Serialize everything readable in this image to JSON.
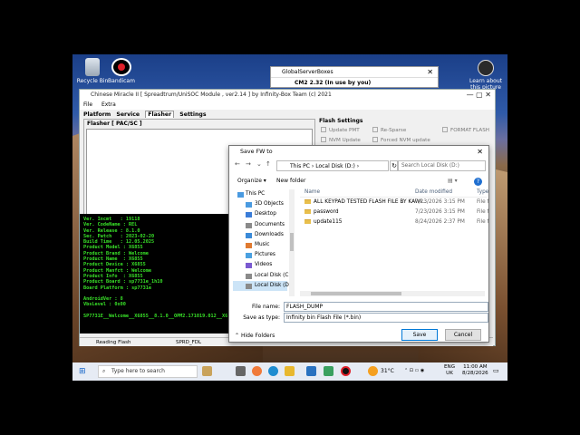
{
  "desktop": {
    "icons": [
      {
        "label": "Recycle Bin"
      },
      {
        "label": "Bandicam"
      },
      {
        "label": "Learn about this picture"
      }
    ]
  },
  "global_server": {
    "title": "GlobalServerBoxes",
    "row": "CM2 2.32 (In use by you)"
  },
  "cm": {
    "title": "Chinese Miracle II [ Spreadtrum/UniSOC Module , ver2.14 ] by Infinity-Box Team (c) 2021",
    "menu": [
      "File",
      "Extra"
    ],
    "tabs": [
      "Platform",
      "Service",
      "Flasher",
      "Settings"
    ],
    "flasher_label": "Flasher [ PAC/SC ]",
    "flash_settings": {
      "heading": "Flash Settings",
      "options": [
        "Update PMT",
        "Re-Sparse",
        "FORMAT FLASH",
        "NVM Update",
        "Forced NVM update"
      ]
    },
    "console": [
      "Ver. Incmt   : 19118",
      "Ver. CodeName : REL",
      "Ver. Release : 8.1.0",
      "Sec. Patch   : 2023-02-20",
      "Build Time   : 12.05.2025",
      "Product Model : X6855",
      "Product Brand : Welcome",
      "Product Name  : X6855",
      "Product Device : X6855",
      "Product Manfct : Welcome",
      "Product Info  : X6855",
      "Product Board : sp7731e_1h10",
      "Board Platform : sp7731e",
      "",
      "AndroidVer : 8",
      "VbsLevel : 0x00",
      "",
      "SP7731E__Welcome__X6855__8.1.0__OPM2.171019.012__X6"
    ],
    "status": {
      "left": "Reading Flash",
      "mid": "SPRD_FDL"
    }
  },
  "dialog": {
    "title": "Save FW to",
    "breadcrumb": [
      "This PC",
      "Local Disk (D:)"
    ],
    "search_placeholder": "Search Local Disk (D:)",
    "organize": "Organize ▾",
    "new_folder": "New folder",
    "tree": [
      "This PC",
      "3D Objects",
      "Desktop",
      "Documents",
      "Downloads",
      "Music",
      "Pictures",
      "Videos",
      "Local Disk (C:)",
      "Local Disk (D:)"
    ],
    "columns": [
      "Name",
      "Date modified",
      "Type"
    ],
    "files": [
      {
        "name": "ALL KEYPAD TESTED FLASH FILE BY KAWI...",
        "date": "7/23/2026 3:15 PM",
        "type": "File f"
      },
      {
        "name": "password",
        "date": "7/23/2026 3:15 PM",
        "type": "File f"
      },
      {
        "name": "update115",
        "date": "8/24/2026 2:37 PM",
        "type": "File f"
      }
    ],
    "file_name_label": "File name:",
    "file_name": "FLASH_DUMP",
    "save_type_label": "Save as type:",
    "save_type": "Infinity bin Flash File (*.bin)",
    "hide_folders": "Hide Folders",
    "save": "Save",
    "cancel": "Cancel"
  },
  "taskbar": {
    "search": "Type here to search",
    "temp": "31°C",
    "lang1": "ENG",
    "lang2": "UK",
    "time": "11:00 AM",
    "date": "8/28/2026"
  }
}
